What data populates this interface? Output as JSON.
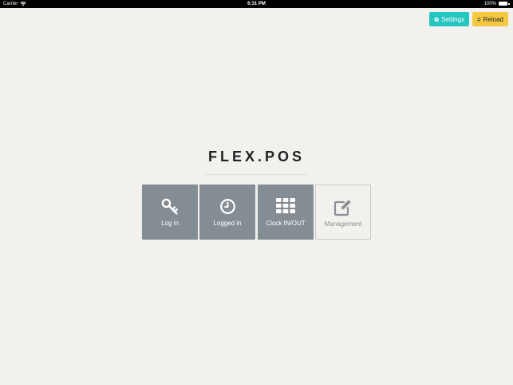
{
  "status_bar": {
    "carrier": "Carrier",
    "time": "6:31 PM",
    "battery": "100%"
  },
  "toolbar": {
    "settings_label": "Settings",
    "reload_label": "Reload"
  },
  "app": {
    "title": "FLEX.POS"
  },
  "tiles": [
    {
      "label": "Log in",
      "icon": "key-icon"
    },
    {
      "label": "Logged in",
      "icon": "clock-icon"
    },
    {
      "label": "Clock IN/OUT",
      "icon": "grid-icon"
    },
    {
      "label": "Management",
      "icon": "edit-icon"
    }
  ],
  "colors": {
    "settings": "#26c6c0",
    "reload": "#f5c842",
    "tile": "#858d94",
    "background": "#f2f1ee"
  }
}
